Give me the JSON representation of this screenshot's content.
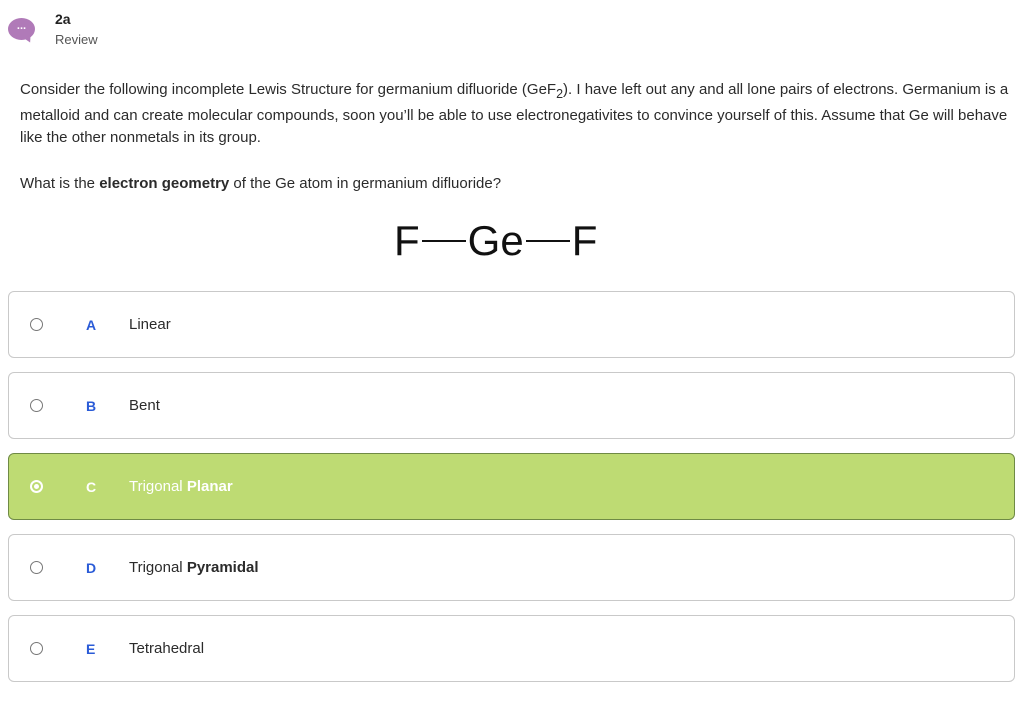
{
  "header": {
    "avatar_icon": "chat-bubble-icon",
    "avatar_glyph": "...",
    "title": "2a",
    "subtitle": "Review"
  },
  "question": {
    "text_before": "Consider the following incomplete Lewis Structure for germanium difluoride (GeF",
    "subscript": "2",
    "text_after": "). I have left out any and all lone pairs of electrons. Germanium is a metalloid and can create molecular compounds, soon you’ll be able to use electronegativites to convince yourself of this. Assume that Ge will behave like the other nonmetals in its group."
  },
  "prompt": {
    "before": "What is the ",
    "bold": "electron geometry",
    "after": " of the Ge atom in germanium difluoride?"
  },
  "lewis_structure": {
    "left_atom": "F",
    "center_atom": "Ge",
    "right_atom": "F"
  },
  "options": [
    {
      "letter": "A",
      "text": "Linear",
      "bold": "",
      "selected": false
    },
    {
      "letter": "B",
      "text": "Bent",
      "bold": "",
      "selected": false
    },
    {
      "letter": "C",
      "text": "Trigonal ",
      "bold": "Planar",
      "selected": true
    },
    {
      "letter": "D",
      "text": "Trigonal ",
      "bold": "Pyramidal",
      "selected": false
    },
    {
      "letter": "E",
      "text": "Tetrahedral",
      "bold": "",
      "selected": false
    }
  ],
  "colors": {
    "selected_bg": "#bedb73",
    "letter_color": "#2a5bd7",
    "avatar_color": "#b07ab8"
  }
}
